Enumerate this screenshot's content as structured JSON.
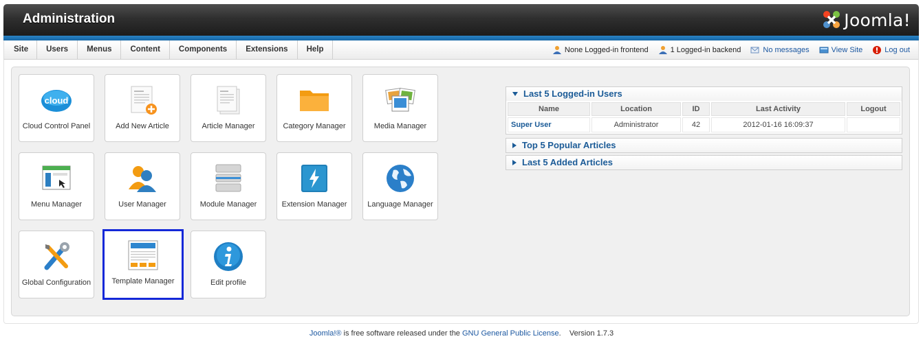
{
  "header": {
    "title": "Administration",
    "brand": "Joomla!"
  },
  "menu": [
    "Site",
    "Users",
    "Menus",
    "Content",
    "Components",
    "Extensions",
    "Help"
  ],
  "status": {
    "frontend": "None Logged-in frontend",
    "backend": "1 Logged-in backend",
    "messages": "No messages",
    "view_site": "View Site",
    "logout": "Log out"
  },
  "icons": [
    {
      "label": "Cloud Control Panel",
      "icon": "cloud-icon"
    },
    {
      "label": "Add New Article",
      "icon": "add-article-icon"
    },
    {
      "label": "Article Manager",
      "icon": "article-icon"
    },
    {
      "label": "Category Manager",
      "icon": "folder-icon"
    },
    {
      "label": "Media Manager",
      "icon": "media-icon"
    },
    {
      "label": "Menu Manager",
      "icon": "menu-icon"
    },
    {
      "label": "User Manager",
      "icon": "user-icon"
    },
    {
      "label": "Module Manager",
      "icon": "module-icon"
    },
    {
      "label": "Extension Manager",
      "icon": "extension-icon"
    },
    {
      "label": "Language Manager",
      "icon": "globe-icon"
    },
    {
      "label": "Global Configuration",
      "icon": "tools-icon"
    },
    {
      "label": "Template Manager",
      "icon": "template-icon",
      "selected": true
    },
    {
      "label": "Edit profile",
      "icon": "info-icon"
    }
  ],
  "panels": {
    "logged_in": {
      "title": "Last 5 Logged-in Users",
      "columns": [
        "Name",
        "Location",
        "ID",
        "Last Activity",
        "Logout"
      ],
      "rows": [
        {
          "name": "Super User",
          "location": "Administrator",
          "id": "42",
          "activity": "2012-01-16 16:09:37",
          "logout": ""
        }
      ]
    },
    "popular": {
      "title": "Top 5 Popular Articles"
    },
    "added": {
      "title": "Last 5 Added Articles"
    }
  },
  "footer": {
    "brand_link": "Joomla!®",
    "text1": " is free software released under the ",
    "license_link": "GNU General Public License",
    "text2": ".",
    "version": "Version 1.7.3"
  },
  "colors": {
    "link": "#1b5b97",
    "header_blue": "#1566a6",
    "selection": "#1428d8"
  }
}
